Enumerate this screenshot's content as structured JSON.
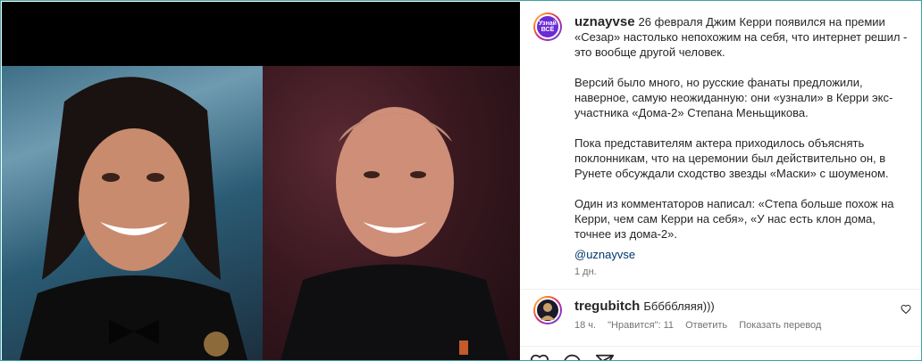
{
  "post": {
    "username": "uznayvse",
    "avatar_text": "Узнай ВСЁ",
    "caption_first": "26 февраля Джим Керри появился на премии «Сезар» настолько непохожим на себя, что интернет решил - это вообще другой человек.",
    "paragraphs": [
      "Версий было много, но русские фанаты предложили, наверное, самую неожиданную: они «узнали» в Керри экс-участника «Дома-2» Степана Меньщикова.",
      "Пока представителям актера приходилось объяснять поклонникам, что на церемонии был действительно он, в Рунете обсуждали сходство звезды «Маски» с шоуменом.",
      "Один из комментаторов написал: «Степа больше похож на Керри, чем сам Керри на себя», «У нас есть клон дома, точнее из дома-2»."
    ],
    "mention": "@uznayvse",
    "time": "1 дн."
  },
  "comment": {
    "username": "tregubitch",
    "text": "Бббббляяя)))",
    "time": "18 ч.",
    "likes": "\"Нравится\": 11",
    "reply": "Ответить",
    "translate": "Показать перевод"
  },
  "icons": {
    "like": "heart-icon",
    "comment": "comment-icon",
    "share": "share-icon"
  },
  "colors": {
    "link": "#00376b",
    "muted": "#737373",
    "avatar_brand": "#6b2bd6"
  }
}
